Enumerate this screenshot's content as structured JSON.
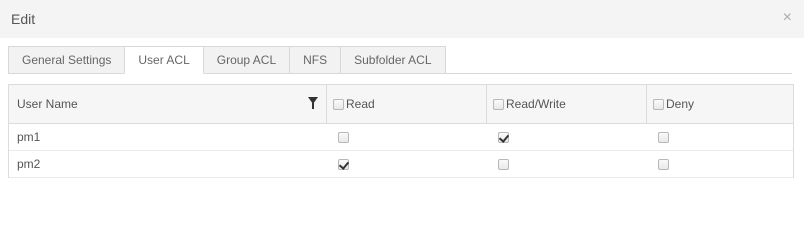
{
  "dialog": {
    "title": "Edit",
    "close_glyph": "×"
  },
  "tabs": [
    {
      "label": "General Settings",
      "active": false
    },
    {
      "label": "User ACL",
      "active": true
    },
    {
      "label": "Group ACL",
      "active": false
    },
    {
      "label": "NFS",
      "active": false
    },
    {
      "label": "Subfolder ACL",
      "active": false
    }
  ],
  "grid": {
    "columns": {
      "user": "User Name",
      "read": "Read",
      "readwrite": "Read/Write",
      "deny": "Deny"
    },
    "rows": [
      {
        "user": "pm1",
        "read": false,
        "readwrite": true,
        "deny": false
      },
      {
        "user": "pm2",
        "read": true,
        "readwrite": false,
        "deny": false
      }
    ]
  },
  "icons": {
    "close": "close-icon",
    "filter": "filter-icon"
  }
}
